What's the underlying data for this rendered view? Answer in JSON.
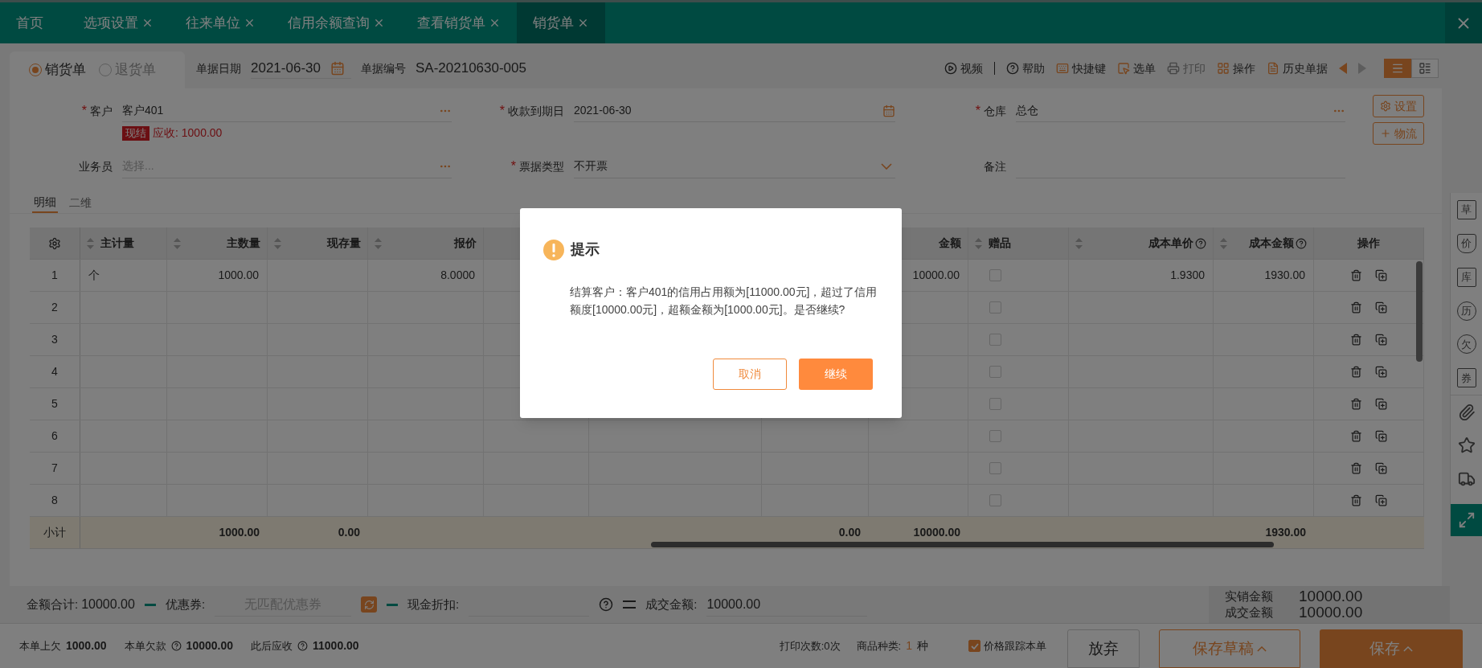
{
  "tabs": [
    {
      "label": "首页",
      "closable": false,
      "selected": false
    },
    {
      "label": "选项设置",
      "closable": true,
      "selected": false
    },
    {
      "label": "往来单位",
      "closable": true,
      "selected": false
    },
    {
      "label": "信用余额查询",
      "closable": true,
      "selected": false
    },
    {
      "label": "查看销货单",
      "closable": true,
      "selected": false
    },
    {
      "label": "销货单",
      "closable": true,
      "selected": true
    }
  ],
  "doc_types": [
    {
      "label": "销货单",
      "selected": true
    },
    {
      "label": "退货单",
      "selected": false
    }
  ],
  "header_fields": [
    {
      "label": "单据日期",
      "value": "2021-06-30",
      "kind": "date"
    },
    {
      "label": "单据编号",
      "value": "SA-20210630-005",
      "kind": "text"
    }
  ],
  "toolbar": [
    {
      "label": "视频",
      "kind": "video",
      "disabled": false
    },
    {
      "label": "帮助",
      "kind": "help",
      "disabled": false
    },
    {
      "label": "快捷键",
      "kind": "shortcut",
      "disabled": false
    },
    {
      "label": "选单",
      "kind": "pick",
      "disabled": false
    },
    {
      "label": "打印",
      "kind": "print",
      "disabled": true
    },
    {
      "label": "操作",
      "kind": "actions",
      "disabled": false
    },
    {
      "label": "历史单据",
      "kind": "history",
      "disabled": false
    }
  ],
  "pager": [
    {
      "kind": "prev",
      "disabled": false
    },
    {
      "kind": "next",
      "disabled": true
    }
  ],
  "view_modes": [
    {
      "kind": "list",
      "selected": true
    },
    {
      "kind": "detail",
      "selected": false
    }
  ],
  "form": {
    "required_mark": "*",
    "customer": {
      "label": "客户",
      "required": true,
      "value": "客户401",
      "settle_badge": "现结",
      "receivable": "应收: 1000.00"
    },
    "salesperson": {
      "label": "业务员",
      "required": false,
      "placeholder": "选择..."
    },
    "due_date": {
      "label": "收款到期日",
      "required": true,
      "value": "2021-06-30"
    },
    "invoice_type": {
      "label": "票据类型",
      "required": true,
      "value": "不开票"
    },
    "warehouse": {
      "label": "仓库",
      "required": true,
      "value": "总仓"
    },
    "remark": {
      "label": "备注",
      "required": false
    }
  },
  "form_buttons": [
    {
      "label": "设置",
      "kind": "settings"
    },
    {
      "label": "物流",
      "kind": "add"
    }
  ],
  "detail_tabs": [
    {
      "label": "明细",
      "selected": true
    },
    {
      "label": "二维",
      "selected": false
    }
  ],
  "table": {
    "columns": [
      {
        "label": "主计量",
        "sortable": true,
        "help": false
      },
      {
        "label": "主数量",
        "sortable": true,
        "help": false
      },
      {
        "label": "现存量",
        "sortable": true,
        "help": false
      },
      {
        "label": "报价",
        "sortable": true,
        "help": false
      },
      {
        "label": "金额",
        "sortable": false,
        "help": false
      },
      {
        "label": "赠品",
        "sortable": true,
        "help": false
      },
      {
        "label": "成本单价",
        "sortable": true,
        "help": true
      },
      {
        "label": "成本金额",
        "sortable": true,
        "help": true
      },
      {
        "label": "操作",
        "sortable": false,
        "help": false
      }
    ],
    "rows": [
      {
        "number": "1",
        "unit": "个",
        "main_qty": "1000.00",
        "quote": "8.0000",
        "amount": "10000.00",
        "gift": false,
        "cost_price": "1.9300",
        "cost_amount": "1930.00"
      },
      {
        "number": "2",
        "gift": false
      },
      {
        "number": "3",
        "gift": false
      },
      {
        "number": "4",
        "gift": false
      },
      {
        "number": "5",
        "gift": false
      },
      {
        "number": "6",
        "gift": false
      },
      {
        "number": "7",
        "gift": false
      },
      {
        "number": "8",
        "gift": false
      }
    ],
    "subtotal": {
      "label": "小计",
      "main_qty": "1000.00",
      "stock": "0.00",
      "column_8": "0.00",
      "amount": "10000.00",
      "cost_amount": "1930.00"
    }
  },
  "summary": {
    "total_label": "金额合计:",
    "total": "10000.00",
    "coupon_label": "优惠券:",
    "coupon_placeholder": "无匹配优惠券",
    "discount_label": "现金折扣:",
    "deal_label": "成交金额:",
    "deal": "10000.00"
  },
  "amount_panel": [
    {
      "label": "实销金额",
      "value": "10000.00"
    },
    {
      "label": "成交金额",
      "value": "10000.00"
    }
  ],
  "footer": {
    "items": [
      {
        "label": "本单上欠",
        "value": "1000.00",
        "help": false
      },
      {
        "label": "本单欠款",
        "value": "10000.00",
        "help": true
      },
      {
        "label": "此后应收",
        "value": "11000.00",
        "help": true
      }
    ],
    "print_count": "打印次数:0次",
    "kinds_label": "商品种类:",
    "kinds": "1",
    "kinds_unit": "种",
    "track_price": {
      "label": "价格跟踪本单",
      "checked": true
    },
    "buttons": [
      {
        "label": "放弃",
        "kind": "plain",
        "menu": false
      },
      {
        "label": "保存草稿",
        "kind": "outline",
        "menu": true
      },
      {
        "label": "保存",
        "kind": "primary",
        "menu": true
      }
    ]
  },
  "side_tools": [
    {
      "kind": "char",
      "label": "草"
    },
    {
      "kind": "shield",
      "label": "价"
    },
    {
      "kind": "char",
      "label": "库"
    },
    {
      "kind": "circle",
      "label": "历"
    },
    {
      "kind": "circle",
      "label": "欠"
    },
    {
      "kind": "char",
      "label": "券"
    },
    {
      "kind": "link"
    },
    {
      "kind": "star"
    },
    {
      "kind": "truck"
    },
    {
      "kind": "expand"
    }
  ],
  "dialog": {
    "title": "提示",
    "message": "结算客户：客户401的信用占用额为[11000.00元]，超过了信用额度[10000.00元]，超额金额为[1000.00元]。是否继续?",
    "buttons": [
      {
        "label": "取消",
        "kind": "secondary"
      },
      {
        "label": "继续",
        "kind": "primary"
      }
    ]
  }
}
